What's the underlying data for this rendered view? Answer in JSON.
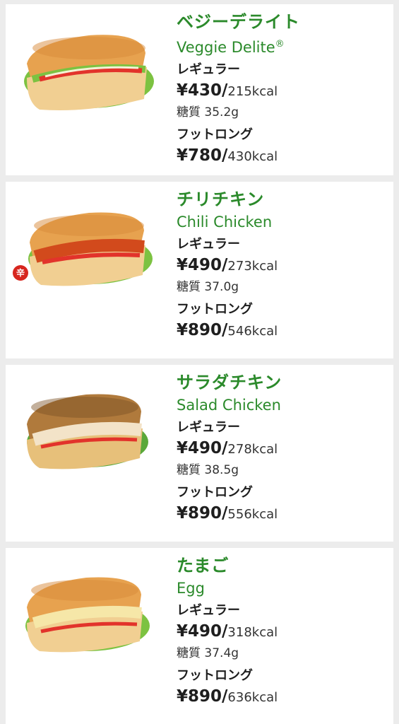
{
  "items": [
    {
      "name_jp": "ベジーデライト",
      "name_en": "Veggie Delite",
      "registered_mark": "®",
      "regular_label": "レギュラー",
      "regular_price": "¥430/",
      "regular_kcal": "215kcal",
      "carb": "糖質 35.2g",
      "footlong_label": "フットロング",
      "footlong_price": "¥780/",
      "footlong_kcal": "430kcal",
      "spicy": false
    },
    {
      "name_jp": "チリチキン",
      "name_en": "Chili Chicken",
      "registered_mark": "",
      "regular_label": "レギュラー",
      "regular_price": "¥490/",
      "regular_kcal": "273kcal",
      "carb": "糖質 37.0g",
      "footlong_label": "フットロング",
      "footlong_price": "¥890/",
      "footlong_kcal": "546kcal",
      "spicy": true,
      "spicy_label": "辛"
    },
    {
      "name_jp": "サラダチキン",
      "name_en": "Salad Chicken",
      "registered_mark": "",
      "regular_label": "レギュラー",
      "regular_price": "¥490/",
      "regular_kcal": "278kcal",
      "carb": "糖質 38.5g",
      "footlong_label": "フットロング",
      "footlong_price": "¥890/",
      "footlong_kcal": "556kcal",
      "spicy": false
    },
    {
      "name_jp": "たまご",
      "name_en": "Egg",
      "registered_mark": "",
      "regular_label": "レギュラー",
      "regular_price": "¥490/",
      "regular_kcal": "318kcal",
      "carb": "糖質 37.4g",
      "footlong_label": "フットロング",
      "footlong_price": "¥890/",
      "footlong_kcal": "636kcal",
      "spicy": false
    }
  ],
  "colors": {
    "accent_green": "#2b8a2b",
    "spicy_red": "#d7261e",
    "background": "#ececec"
  }
}
